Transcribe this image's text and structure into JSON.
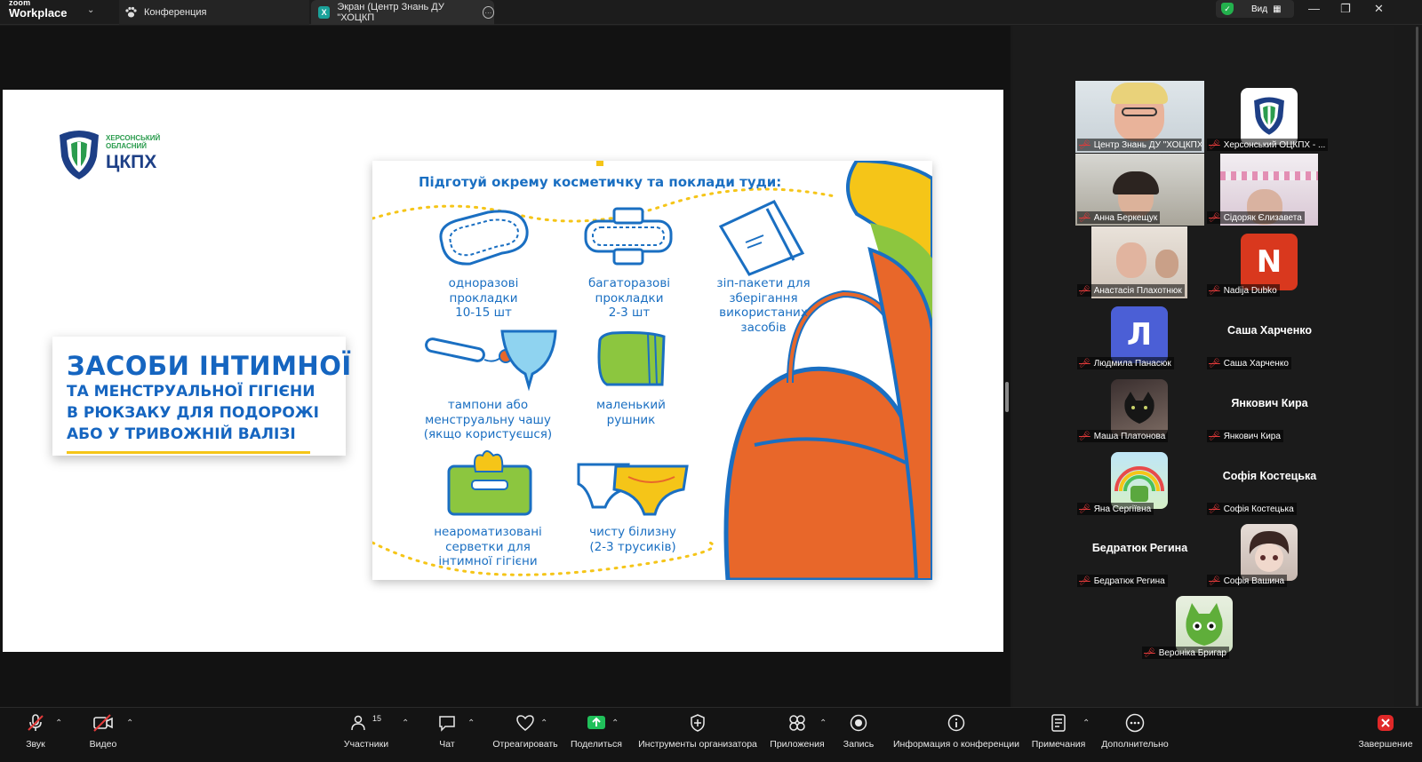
{
  "topbar": {
    "brand_small": "zoom",
    "brand_big": "Workplace",
    "tab_conference": "Конференция",
    "tab_screen": "Экран (Центр Знань ДУ \"ХОЦКП",
    "view_label": "Вид"
  },
  "slide": {
    "logo_small": "ХЕРСОНСЬКИЙ\nОБЛАСНИЙ",
    "logo_big": "ЦКПХ",
    "title_line1": "ЗАСОБИ ІНТИМНОЇ",
    "title_line2": "ТА МЕНСТРУАЛЬНОЇ ГІГІЄНИ",
    "title_line3": "В РЮКЗАКУ ДЛЯ ПОДОРОЖІ",
    "title_line4": "АБО У ТРИВОЖНІЙ ВАЛІЗІ",
    "poster_heading": "Підготуй окрему косметичку та поклади туди:",
    "items": [
      "одноразові\nпрокладки\n10-15 шт",
      "багаторазові\nпрокладки\n2-3 шт",
      "зіп-пакети для\nзберігання\nвикористаних\nзасобів",
      "тампони або\nменструальну чашу\n(якщо користуєшся)",
      "маленький\nрушник",
      "неароматизовані\nсерветки для\nінтимної гігієни",
      "чисту білизну\n(2-3 трусиків)"
    ]
  },
  "colors": {
    "poster_blue": "#1a6fc2",
    "poster_orange": "#e8672a",
    "poster_yellow": "#f5c518",
    "poster_green": "#8cc63f",
    "active_speaker": "#38d36b"
  },
  "participants": [
    {
      "name": "Центр Знань ДУ \"ХОЦКПХ...",
      "type": "video",
      "active": true
    },
    {
      "name": "Херсонський ОЦКПХ - ...",
      "type": "logo"
    },
    {
      "name": "Анна Беркещук",
      "type": "video"
    },
    {
      "name": "Сідоряк Єлизавета",
      "type": "video"
    },
    {
      "name": "Анастасія Плахотнюк",
      "type": "video"
    },
    {
      "name": "Nadija Dubko",
      "type": "avatar",
      "letter": "N",
      "color": "#d9381e"
    },
    {
      "name": "Людмила Панасюк",
      "type": "avatar",
      "letter": "Л",
      "color": "#4b5fd6"
    },
    {
      "name": "Саша Харченко",
      "type": "text"
    },
    {
      "name": "Маша Платонова",
      "type": "photo"
    },
    {
      "name": "Янкович Кира",
      "type": "text"
    },
    {
      "name": "Яна Сергіївна",
      "type": "photo"
    },
    {
      "name": "Софія Костецька",
      "type": "text"
    },
    {
      "name": "Бедратюк Регина",
      "type": "text"
    },
    {
      "name": "Софія Вашина",
      "type": "photo"
    },
    {
      "name": "Вероніка Бригар",
      "type": "photo"
    }
  ],
  "toolbar": {
    "audio": "Звук",
    "video": "Видео",
    "participants": "Участники",
    "participants_count": "15",
    "chat": "Чат",
    "react": "Отреагировать",
    "share": "Поделиться",
    "host_tools": "Инструменты организатора",
    "apps": "Приложения",
    "record": "Запись",
    "info": "Информация о конференции",
    "notes": "Примечания",
    "more": "Дополнительно",
    "end": "Завершение"
  }
}
